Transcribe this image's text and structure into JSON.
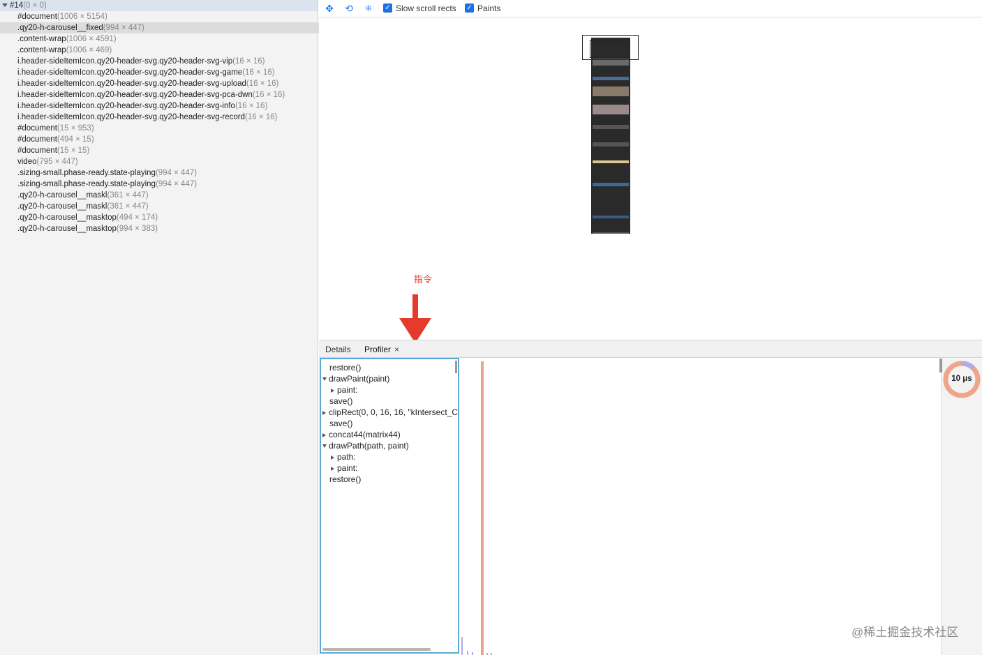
{
  "layer_tree": {
    "root": {
      "name": "#14",
      "size": "(0 × 0)"
    },
    "items": [
      {
        "name": "#document",
        "size": "(1006 × 5154)"
      },
      {
        "name": ".qy20-h-carousel__fixed",
        "size": "(994 × 447)"
      },
      {
        "name": ".content-wrap",
        "size": "(1006 × 4591)"
      },
      {
        "name": ".content-wrap",
        "size": "(1006 × 469)"
      },
      {
        "name": "i.header-sideItemIcon.qy20-header-svg.qy20-header-svg-vip",
        "size": "(16 × 16)"
      },
      {
        "name": "i.header-sideItemIcon.qy20-header-svg.qy20-header-svg-game",
        "size": "(16 × 16)"
      },
      {
        "name": "i.header-sideItemIcon.qy20-header-svg.qy20-header-svg-upload",
        "size": "(16 × 16)"
      },
      {
        "name": "i.header-sideItemIcon.qy20-header-svg.qy20-header-svg-pca-dwn",
        "size": "(16 × 16)"
      },
      {
        "name": "i.header-sideItemIcon.qy20-header-svg.qy20-header-svg-info",
        "size": "(16 × 16)"
      },
      {
        "name": "i.header-sideItemIcon.qy20-header-svg.qy20-header-svg-record",
        "size": "(16 × 16)"
      },
      {
        "name": "#document",
        "size": "(15 × 953)"
      },
      {
        "name": "#document",
        "size": "(494 × 15)"
      },
      {
        "name": "#document",
        "size": "(15 × 15)"
      },
      {
        "name": "video",
        "size": "(795 × 447)"
      },
      {
        "name": ".sizing-small.phase-ready.state-playing",
        "size": "(994 × 447)"
      },
      {
        "name": ".sizing-small.phase-ready.state-playing",
        "size": "(994 × 447)"
      },
      {
        "name": ".qy20-h-carousel__maskl",
        "size": "(361 × 447)"
      },
      {
        "name": ".qy20-h-carousel__maskl",
        "size": "(361 × 447)"
      },
      {
        "name": ".qy20-h-carousel__masktop",
        "size": "(494 × 174)"
      },
      {
        "name": ".qy20-h-carousel__masktop",
        "size": "(994 × 383)"
      }
    ]
  },
  "toolbar": {
    "icons": [
      "pan-mode-icon",
      "rotate-mode-icon",
      "reset-transform-icon"
    ],
    "slow_scroll_label": "Slow scroll rects",
    "paints_label": "Paints",
    "accent": "#1a73e8"
  },
  "annotation": {
    "label": "指令",
    "color": "#e53b2c"
  },
  "tabs": {
    "details": "Details",
    "profiler": "Profiler",
    "close": "×"
  },
  "command_log": [
    {
      "text": "restore()",
      "indent": 0,
      "toggle": "none"
    },
    {
      "text": "drawPaint(paint)",
      "indent": 0,
      "toggle": "down"
    },
    {
      "text": "paint:",
      "indent": 1,
      "toggle": "right"
    },
    {
      "text": "save()",
      "indent": 0,
      "toggle": "none"
    },
    {
      "text": "clipRect(0, 0, 16, 16, \"kIntersect_C",
      "indent": 0,
      "toggle": "right"
    },
    {
      "text": "save()",
      "indent": 0,
      "toggle": "none"
    },
    {
      "text": "concat44(matrix44)",
      "indent": 0,
      "toggle": "right"
    },
    {
      "text": "drawPath(path, paint)",
      "indent": 0,
      "toggle": "down"
    },
    {
      "text": "path:",
      "indent": 1,
      "toggle": "right"
    },
    {
      "text": "paint:",
      "indent": 1,
      "toggle": "right"
    },
    {
      "text": "restore()",
      "indent": 0,
      "toggle": "none"
    }
  ],
  "profiler": {
    "total_time": "10 μs",
    "gauge_colors": {
      "main": "#efa58a",
      "secondary": "#b7a9e8"
    }
  },
  "watermark": "@稀土掘金技术社区"
}
